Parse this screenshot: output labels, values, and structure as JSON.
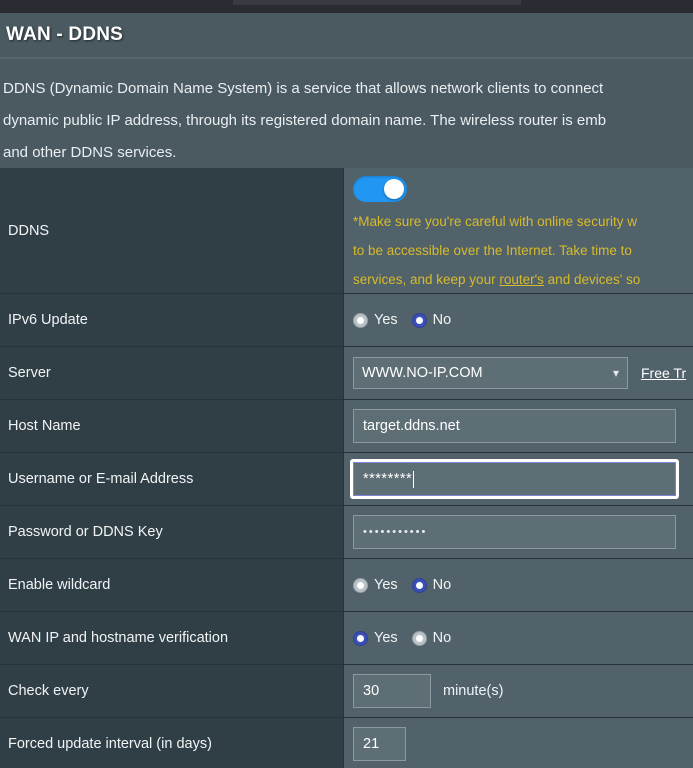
{
  "page": {
    "title": "WAN - DDNS",
    "description_lines": [
      "DDNS (Dynamic Domain Name System) is a service that allows network clients to connect",
      "dynamic public IP address, through its registered domain name. The wireless router is emb",
      "and other DDNS services."
    ]
  },
  "rows": {
    "ddns": {
      "label": "DDNS",
      "toggle_state": "on",
      "warning_lines": [
        "*Make sure you're careful with online security w",
        "to be accessible over the Internet. Take time to",
        "services, and keep your "
      ],
      "warning_link": "router's",
      "warning_tail": " and devices' so"
    },
    "ipv6_update": {
      "label": "IPv6 Update",
      "yes_label": "Yes",
      "no_label": "No",
      "selected": "No"
    },
    "server": {
      "label": "Server",
      "value": "WWW.NO-IP.COM",
      "chevron": "chevron-down-icon",
      "free_trial_label": "Free Tr"
    },
    "host_name": {
      "label": "Host Name",
      "value": "target.ddns.net"
    },
    "username": {
      "label": "Username or E-mail Address",
      "value": "********",
      "focused": true
    },
    "password": {
      "label": "Password or DDNS Key",
      "value": "•••••••••••"
    },
    "wildcard": {
      "label": "Enable wildcard",
      "yes_label": "Yes",
      "no_label": "No",
      "selected": "No"
    },
    "wan_verification": {
      "label": "WAN IP and hostname verification",
      "yes_label": "Yes",
      "no_label": "No",
      "selected": "Yes"
    },
    "check_every": {
      "label": "Check every",
      "value": "30",
      "unit": "minute(s)"
    },
    "forced_update": {
      "label": "Forced update interval (in days)",
      "value": "21"
    }
  },
  "colors": {
    "accent_blue": "#2196f3",
    "warning_yellow": "#d8bb2b",
    "label_bg": "#303f46",
    "value_bg": "#51626a",
    "header_bg": "#4a5a60"
  }
}
